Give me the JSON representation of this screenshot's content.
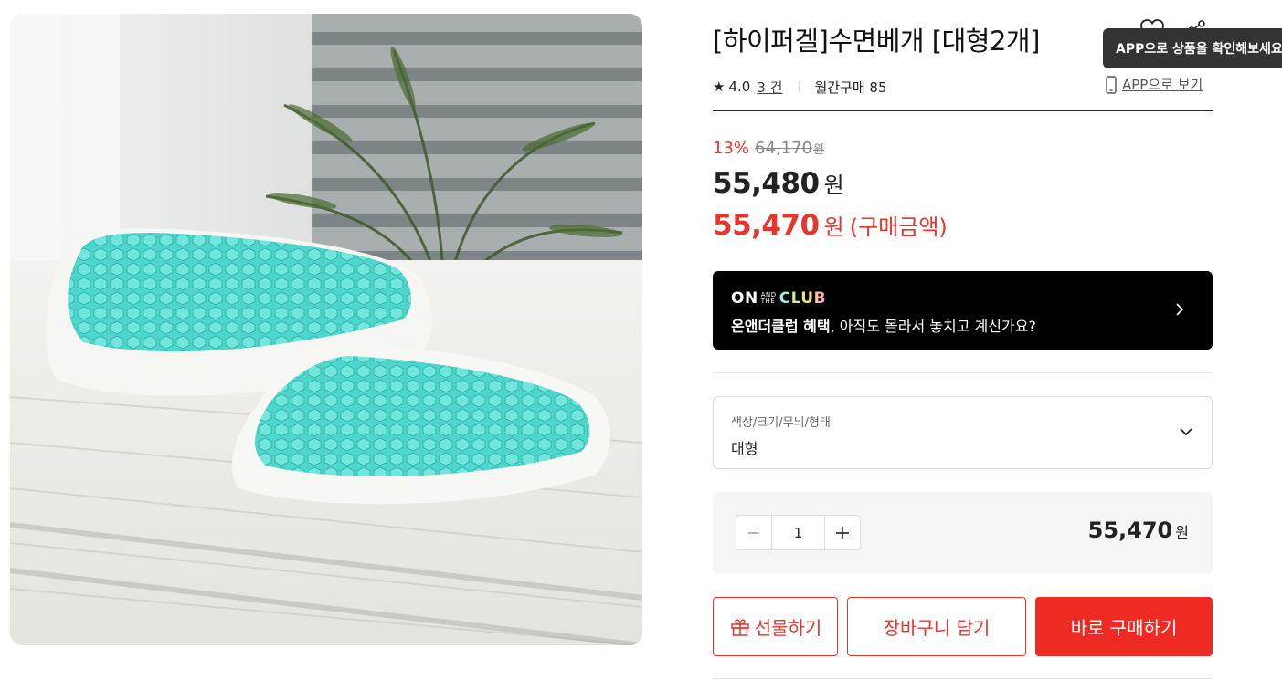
{
  "product": {
    "title": "[하이퍼겔]수면베개 [대형2개]",
    "rating": "4.0",
    "review_count": "3 건",
    "monthly_purchase": "월간구매 85",
    "app_view_label": "APP으로 보기",
    "tooltip": "APP으로 상품을 확인해보세요"
  },
  "pricing": {
    "discount_rate": "13%",
    "original_price": "64,170",
    "original_unit": "원",
    "price": "55,480",
    "price_unit": "원",
    "final_price": "55,470",
    "final_unit": "원",
    "final_label": "(구매금액)"
  },
  "banner": {
    "logo_on": "ON",
    "logo_and": "AND",
    "logo_the": "THE",
    "logo_club": "CLUB",
    "text_bold": "온앤더클럽 혜택",
    "text_rest": ", 아직도 몰라서 놓치고 계신가요?"
  },
  "option": {
    "label": "색상/크기/무늬/형태",
    "value": "대형"
  },
  "quantity": {
    "value": "1",
    "total": "55,470",
    "unit": "원"
  },
  "actions": {
    "gift": "선물하기",
    "cart": "장바구니 담기",
    "buy": "바로 구매하기"
  },
  "colors": {
    "accent_red": "#ee2b23",
    "discount_red": "#e5362c",
    "gel_teal": "#4fd6cc",
    "banner_bg": "#000000"
  },
  "icons": [
    "star-icon",
    "heart-icon",
    "share-icon",
    "phone-icon",
    "chevron-right-icon",
    "chevron-down-icon",
    "minus-icon",
    "plus-icon",
    "gift-icon"
  ]
}
